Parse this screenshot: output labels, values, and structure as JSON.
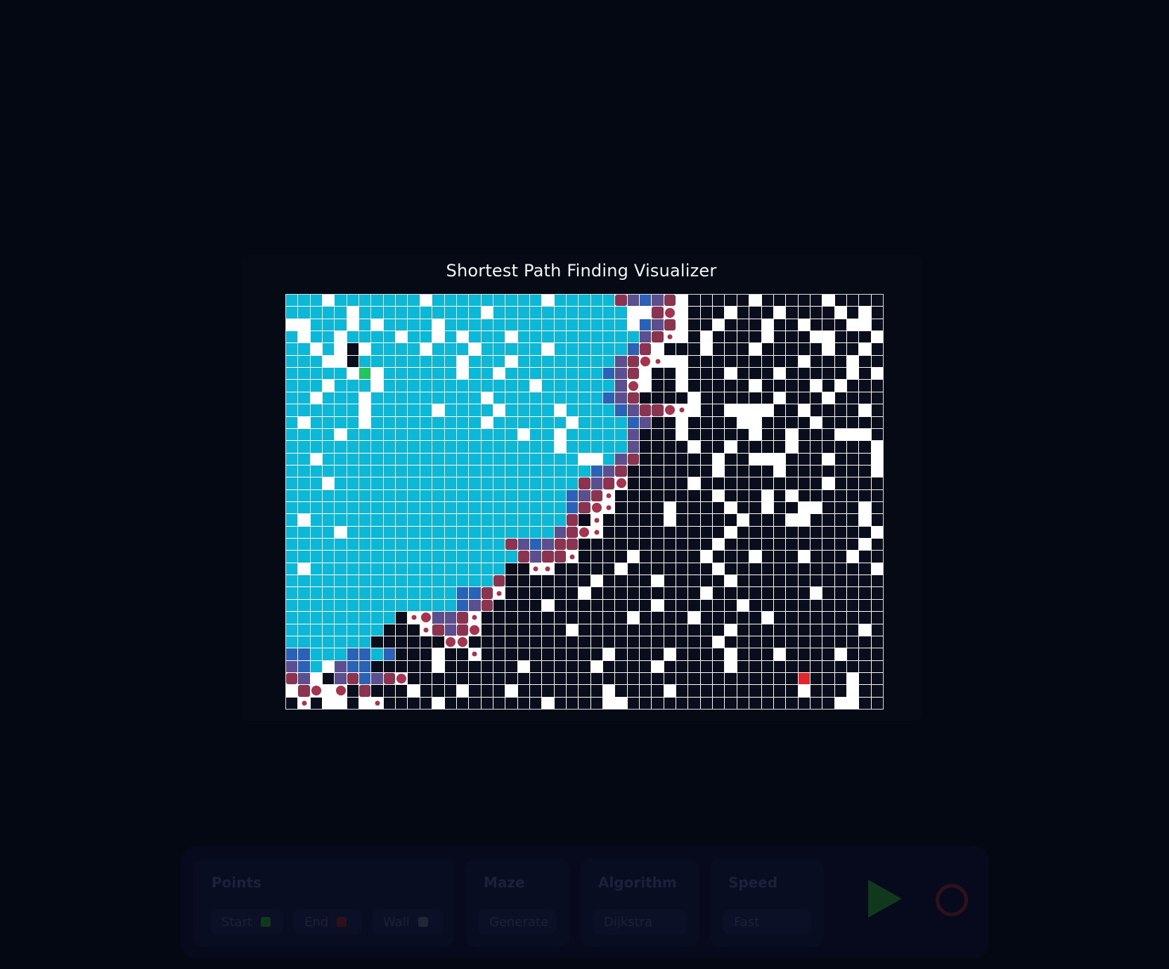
{
  "title": "Shortest Path Finding Visualizer",
  "colors": {
    "empty": "#ffffff",
    "wall": "#0a0d1c",
    "visited": "#0cb8d6",
    "frontier": "#2a62b8",
    "frontier2": "#5b4f8f",
    "path": "#8a3452",
    "start": "#22c45e",
    "end": "#e3262b"
  },
  "grid": {
    "legend": {
      "W": "wall",
      "V": "visited",
      "B": "frontier",
      "U": "frontier2",
      "P": "path",
      "o": "small-dot",
      "O": "large-dot",
      "S": "start",
      "E": "end",
      ".": "empty"
    },
    "rows": [
      "VVV.VVVVVVV.VVVVVVVVV.VVVVVPUBUP.WWWWW.WWWWW.WWWW",
      "VVVVV.VVVVVVVVVV.VVVVVVVVVVV..PO.WWW.WWW.WWWW.W.W",
      "..VVV.V.VVVV.VVVVVVVVVVVVVVV.BUP.WW.WWW.WW.WWW..W",
      "V.VV.VVVV.VV.V.VVV.VVVVVVVVVVUPo.W.WWWW.WWW..WWW.",
      "VV.V.W.VVVV.VVV.VVVVV.VVVVVVBP.WWW.WWW.WWWWW.WW.W",
      "VVV..WVVVVVVVV.VVV.VVVVVVVVUPOo..WWWWWWWWW.WWW.WW",
      "VVVVV.S.VVVVVV.VV.VVVVVVVVBUP.WW.WWW.WWW.WWWWW.W.",
      "VVV.VVV.VVVVVVVVVVVV.VVVVVVUO.WW.WWWWW.WWWW.W.WWW",
      "VV.VVV.VVVVVVVVV.VVVVVVVVVBUPWWWW.WWWWWW.WWW.WWWW",
      "VVVVVV.VVVVV.VVVV.VVVV.VVVVBUPPOo.WW....WW.WWWW.W",
      "V.VVVV.VVVVVVVVV.VVVVVV.VVVVBUWW.WWWW..WWWW.WWWWW",
      "VVVV.VVVVVVVVVVVVVV.VV.VVVVVUWWW.WWWWW.WW.WWW...W",
      "VVVVVVVVVVVVVVVVVVVVVV.VVVVVUWWWW.WW.WWWW.WWWWWW.",
      "VV.VVVVVVVVVVVVVVVVVVVVV..VUPWWWWWW.WW...WWW.WWW.",
      "VVVVVVVVVVVVVVVVVVVVVVVVVBUPWWWWWWW.WWWW.WWWWWWW.",
      "VVV.VVVVVVVVVVVVVVVVVVVVPUPOWWWWW.WWWWWWWWWW.WWWW",
      "VVVVVVVVVVVVVVVVVVVVVVVBUPoWWWWWWWW.WWW.W.WWWWWWW",
      "VVVVVVVVVVVVVVVVVVVVVVVBPOoWWWW.WWWW.WW.WW..WWW.W",
      "V.VVVVVVVVVVVVVVVVVVVVVPWoWWWWW.WWWWW.WWW..WWWW.W",
      "VVVV.VVVVVVVVVVVVVVVVVUPOoWWWWWWWWWW.WWWWWWWWWWW.",
      "VVVVVVVVVVVVVVVVVVPUBUPPWWWWWWWWWWW.WWWWWWWWWWW.W",
      "VVVVVVVVVVVVVVVVVVVPUPPoWWWW.WWWWW.WWW.WWW.WWW.WW",
      "V.VVVVVVVVVVVVVVVVWWooWWWWW.WWWWWWW.WWWWWWWWWWWW.",
      "VVVVVVVVVVVVVVVVVPWWWWWWW.WWWW.WWWWW.WWWWWWWWWWWW",
      "VVVVVVVVVVVVVVBBPoWWWWWW.WWWWWWWWW.WWWWWWWW.WWWWW",
      "VVVVVVVVVVVVVVBUPWWWW.WWWWWWWW.WWWWWW.WWWWWWWWWWW",
      "VVVVVVVVVWoOUUPoWWWWWWWWWWWW.WWWW.WWWWW.WWWWWWWWW",
      "VVVVVVVVWWWoPUPOWWWWWWW.WWWWWWWWWWWW.WWWWWWWWWW.W",
      "VVVVVVVWWWWWWOOWWWWWWWWWWWWWWWWWWWW.WWWWWWWWWWWWW",
      "BBVVVBBVBWWW.WWoWWWWWWWWWW.WWWW.WWWW.WWW.WWWW.WWW",
      "UBV.UBBWWWWW.WWWWWW.WWWWW.WWWW.WWWWW.WWWWWWWWWWWW",
      "PU.WUPBUPOWWWWWWWWWWWWWWWWWWWWWWWWWWWWWWWWEWWW.WW",
      ".PO.OWPWWW.WWW.WWW.WWWWWWW.WWWW.WWWWWWWWWW.WWW.WW",
      "WoW..W.oWWWW.WWWWWWWW.WWWW..WWWWWWWWWWWWWWWWW..WW"
    ]
  },
  "toolbar": {
    "points_label": "Points",
    "start_label": "Start",
    "end_label": "End",
    "wall_label": "Wall",
    "maze_label": "Maze",
    "generate_label": "Generate",
    "algorithm_label": "Algorithm",
    "algorithm_value": "Dijkstra",
    "speed_label": "Speed",
    "speed_value": "Fast"
  }
}
